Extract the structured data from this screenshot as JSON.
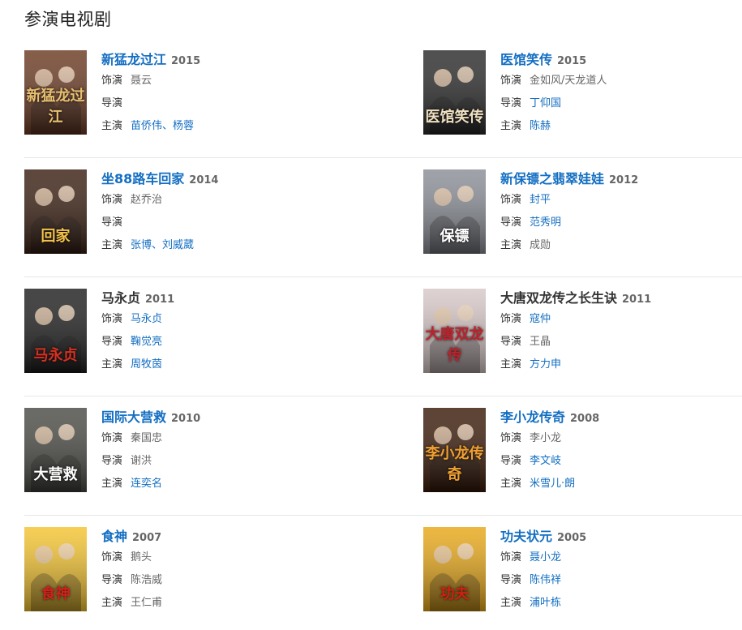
{
  "section_title": "参演电视剧",
  "labels": {
    "role": "饰演",
    "director": "导演",
    "star": "主演"
  },
  "items": [
    {
      "title": "新猛龙过江",
      "year": "2015",
      "title_link": true,
      "role": "聂云",
      "role_link": false,
      "director": "",
      "director_link": false,
      "star_a": "苗侨伟",
      "star_sep": "、",
      "star_b": "杨蓉",
      "star_link": true,
      "poster_text": "新猛龙过江",
      "poster_bg": "#6b3a22",
      "poster_fg": "#e8c070"
    },
    {
      "title": "医馆笑传",
      "year": "2015",
      "title_link": true,
      "role": "金如风/天龙道人",
      "role_link": false,
      "director": "丁仰国",
      "director_link": true,
      "star_a": "陈赫",
      "star_sep": "",
      "star_b": "",
      "star_link": true,
      "poster_text": "医馆笑传",
      "poster_bg": "#2a2a2a",
      "poster_fg": "#f0e0c0"
    },
    {
      "title": "坐88路车回家",
      "year": "2014",
      "title_link": true,
      "role": "赵乔治",
      "role_link": false,
      "director": "",
      "director_link": false,
      "star_a": "张博",
      "star_sep": "、",
      "star_b": "刘威葳",
      "star_link": true,
      "poster_text": "回家",
      "poster_bg": "#3a1f12",
      "poster_fg": "#f4c24a"
    },
    {
      "title": "新保镖之翡翠娃娃",
      "year": "2012",
      "title_link": true,
      "role": "封平",
      "role_link": true,
      "director": "范秀明",
      "director_link": true,
      "star_a": "成勋",
      "star_sep": "",
      "star_b": "",
      "star_link": false,
      "poster_text": "保镖",
      "poster_bg": "#8a8e96",
      "poster_fg": "#ffffff"
    },
    {
      "title": "马永贞",
      "year": "2011",
      "title_link": false,
      "role": "马永贞",
      "role_link": true,
      "director": "鞠觉亮",
      "director_link": true,
      "star_a": "周牧茵",
      "star_sep": "",
      "star_b": "",
      "star_link": true,
      "poster_text": "马永贞",
      "poster_bg": "#1e1e1e",
      "poster_fg": "#d93020"
    },
    {
      "title": "大唐双龙传之长生诀",
      "year": "2011",
      "title_link": false,
      "role": "寇仲",
      "role_link": true,
      "director": "王晶",
      "director_link": false,
      "star_a": "方力申",
      "star_sep": "",
      "star_b": "",
      "star_link": true,
      "poster_text": "大唐双龙传",
      "poster_bg": "#d8c8c8",
      "poster_fg": "#c0202a"
    },
    {
      "title": "国际大营救",
      "year": "2010",
      "title_link": true,
      "role": "秦国忠",
      "role_link": false,
      "director": "谢洪",
      "director_link": false,
      "star_a": "连奕名",
      "star_sep": "",
      "star_b": "",
      "star_link": true,
      "poster_text": "大营救",
      "poster_bg": "#4a4a44",
      "poster_fg": "#ffffff"
    },
    {
      "title": "李小龙传奇",
      "year": "2008",
      "title_link": true,
      "role": "李小龙",
      "role_link": false,
      "director": "李文岐",
      "director_link": true,
      "star_a": "米雪儿·朗",
      "star_sep": "",
      "star_b": "",
      "star_link": true,
      "poster_text": "李小龙传奇",
      "poster_bg": "#3a1a08",
      "poster_fg": "#f0a030"
    },
    {
      "title": "食神",
      "year": "2007",
      "title_link": true,
      "role": "鹅头",
      "role_link": false,
      "director": "陈浩威",
      "director_link": false,
      "star_a": "王仁甫",
      "star_sep": "",
      "star_b": "",
      "star_link": false,
      "poster_text": "食神",
      "poster_bg": "#f4c430",
      "poster_fg": "#d0201a"
    },
    {
      "title": "功夫状元",
      "year": "2005",
      "title_link": true,
      "role": "聂小龙",
      "role_link": true,
      "director": "陈伟祥",
      "director_link": true,
      "star_a": "浦叶栋",
      "star_sep": "",
      "star_b": "",
      "star_link": true,
      "poster_text": "功夫",
      "poster_bg": "#e8a818",
      "poster_fg": "#d02010"
    }
  ]
}
